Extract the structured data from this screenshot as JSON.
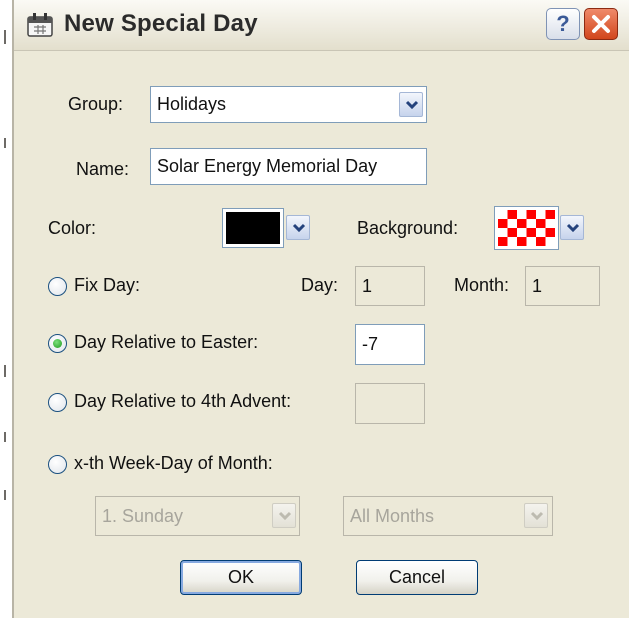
{
  "window": {
    "title": "New Special Day"
  },
  "form": {
    "group_label": "Group:",
    "group_value": "Holidays",
    "name_label": "Name:",
    "name_value": "Solar Energy Memorial Day",
    "color_label": "Color:",
    "color_value": "#000000",
    "background_label": "Background:",
    "background_pattern_colors": [
      "#ff0000",
      "#ffffff"
    ],
    "fix_day_label": "Fix Day:",
    "day_label": "Day:",
    "day_value": "1",
    "month_label": "Month:",
    "month_value": "1",
    "easter_label": "Day Relative to Easter:",
    "easter_value": "-7",
    "advent_label": "Day Relative to 4th Advent:",
    "advent_value": "",
    "weekday_label": "x-th Week-Day of Month:",
    "weekday_value": "1. Sunday",
    "months_value": "All Months",
    "selected_option": "easter"
  },
  "buttons": {
    "ok": "OK",
    "cancel": "Cancel"
  },
  "icons": {
    "app": "calendar-icon",
    "help": "help-icon",
    "close": "close-icon",
    "dropdown": "chevron-down-icon"
  }
}
